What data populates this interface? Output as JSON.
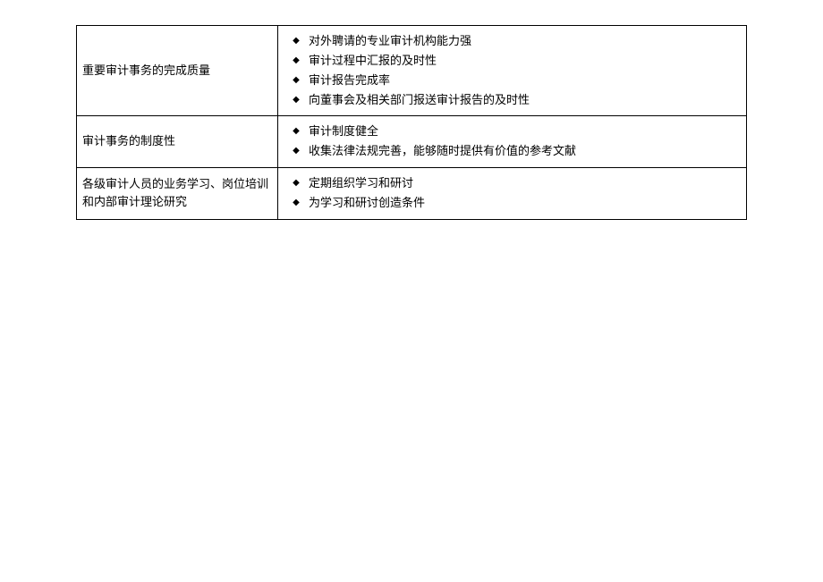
{
  "rows": [
    {
      "label": "重要审计事务的完成质量",
      "items": [
        "对外聘请的专业审计机构能力强",
        "审计过程中汇报的及时性",
        "审计报告完成率",
        "向董事会及相关部门报送审计报告的及时性"
      ]
    },
    {
      "label": "审计事务的制度性",
      "items": [
        "审计制度健全",
        "收集法律法规完善，能够随时提供有价值的参考文献"
      ]
    },
    {
      "label": "各级审计人员的业务学习、岗位培训和内部审计理论研究",
      "items": [
        "定期组织学习和研讨",
        "为学习和研讨创造条件"
      ]
    }
  ]
}
